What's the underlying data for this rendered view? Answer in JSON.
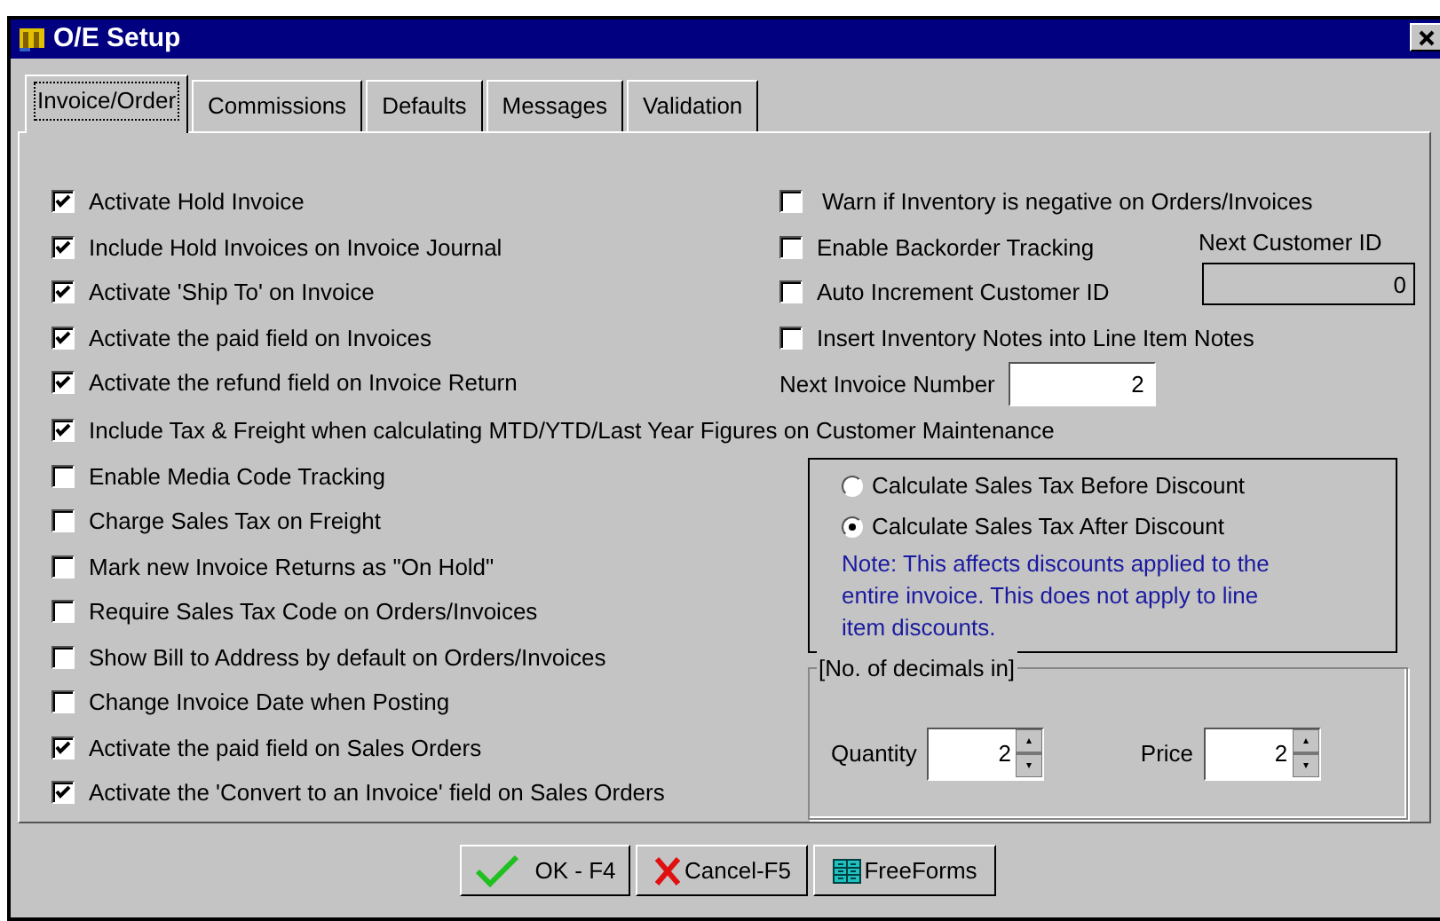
{
  "window": {
    "title": "O/E Setup"
  },
  "tabs": [
    {
      "label": "Invoice/Order",
      "selected": true
    },
    {
      "label": "Commissions",
      "selected": false
    },
    {
      "label": "Defaults",
      "selected": false
    },
    {
      "label": "Messages",
      "selected": false
    },
    {
      "label": "Validation",
      "selected": false
    }
  ],
  "left_options": [
    {
      "label": "Activate Hold Invoice",
      "checked": true
    },
    {
      "label": "Include Hold Invoices on Invoice Journal",
      "checked": true
    },
    {
      "label": "Activate 'Ship To' on Invoice",
      "checked": true
    },
    {
      "label": "Activate the paid field on Invoices",
      "checked": true
    },
    {
      "label": "Activate the refund field on Invoice Return",
      "checked": true
    }
  ],
  "right_options": [
    {
      "label": "Warn if Inventory is negative on Orders/Invoices",
      "checked": false
    },
    {
      "label": "Enable Backorder Tracking",
      "checked": false
    },
    {
      "label": "Auto Increment Customer ID",
      "checked": false
    },
    {
      "label": "Insert Inventory Notes into Line Item Notes",
      "checked": false
    }
  ],
  "next_customer_id": {
    "label": "Next Customer ID",
    "value": "0"
  },
  "next_invoice_number": {
    "label": "Next Invoice Number",
    "value": "2"
  },
  "wide_option": {
    "label": "Include Tax & Freight when calculating MTD/YTD/Last Year Figures on Customer Maintenance",
    "checked": true
  },
  "more_options": [
    {
      "label": "Enable Media Code Tracking",
      "checked": false
    },
    {
      "label": "Charge Sales Tax on Freight",
      "checked": false
    },
    {
      "label": "Mark new Invoice Returns as \"On Hold\"",
      "checked": false
    },
    {
      "label": "Require Sales Tax Code on Orders/Invoices",
      "checked": false
    },
    {
      "label": "Show Bill to Address by default on Orders/Invoices",
      "checked": false
    },
    {
      "label": "Change Invoice Date when Posting",
      "checked": false
    },
    {
      "label": "Activate the paid field on Sales Orders",
      "checked": true
    },
    {
      "label": "Activate the 'Convert to an Invoice' field on Sales Orders",
      "checked": true
    }
  ],
  "sales_tax_mode": {
    "options": [
      {
        "label": "Calculate Sales Tax Before Discount",
        "selected": false
      },
      {
        "label": "Calculate Sales Tax After Discount",
        "selected": true
      }
    ],
    "note": "Note: This affects discounts applied to the entire invoice. This does not apply to line item discounts."
  },
  "decimals": {
    "legend": "[No. of decimals in]",
    "quantity": {
      "label": "Quantity",
      "value": "2"
    },
    "price": {
      "label": "Price",
      "value": "2"
    }
  },
  "buttons": [
    {
      "kind": "ok",
      "label": "OK - F4"
    },
    {
      "kind": "cancel",
      "label": "Cancel-F5"
    },
    {
      "kind": "freeforms",
      "label": "FreeForms"
    }
  ]
}
